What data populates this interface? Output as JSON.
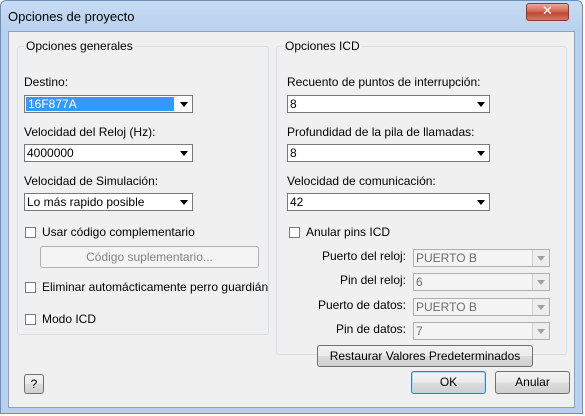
{
  "window": {
    "title": "Opciones de proyecto",
    "close_label": "✕"
  },
  "general": {
    "legend": "Opciones generales",
    "destino_label": "Destino:",
    "destino_value": "16F877A",
    "reloj_label": "Velocidad del Reloj (Hz):",
    "reloj_value": "4000000",
    "simulacion_label": "Velocidad de Simulación:",
    "simulacion_value": "Lo más rapido posible",
    "usar_codigo_label": "Usar código complementario",
    "usar_codigo_checked": false,
    "codigo_button": "Código suplementario...",
    "eliminar_label": "Eliminar automácticamente perro guardián",
    "eliminar_checked": false,
    "modo_icd_label": "Modo ICD",
    "modo_icd_checked": false
  },
  "icd": {
    "legend": "Opciones ICD",
    "recuento_label": "Recuento de puntos de interrupción:",
    "recuento_value": "8",
    "profundidad_label": "Profundidad de la pila de llamadas:",
    "profundidad_value": "8",
    "comunicacion_label": "Velocidad de comunicación:",
    "comunicacion_value": "42",
    "anular_label": "Anular pins ICD",
    "anular_checked": false,
    "puerto_reloj_label": "Puerto del reloj:",
    "puerto_reloj_value": "PUERTO B",
    "pin_reloj_label": "Pin del reloj:",
    "pin_reloj_value": "6",
    "puerto_datos_label": "Puerto de datos:",
    "puerto_datos_value": "PUERTO B",
    "pin_datos_label": "Pin de datos:",
    "pin_datos_value": "7",
    "restaurar_button": "Restaurar Valores Predeterminados"
  },
  "footer": {
    "help_button": "?",
    "ok_button": "OK",
    "cancel_button": "Anular"
  },
  "icons": {
    "close": "close-icon",
    "dropdown": "chevron-down-icon",
    "checkbox": "checkbox-icon"
  },
  "colors": {
    "selection": "#3399ff",
    "titlebar": "#b9d1ee",
    "close_button": "#c0472f",
    "dialog_bg": "#f0f0f0"
  }
}
